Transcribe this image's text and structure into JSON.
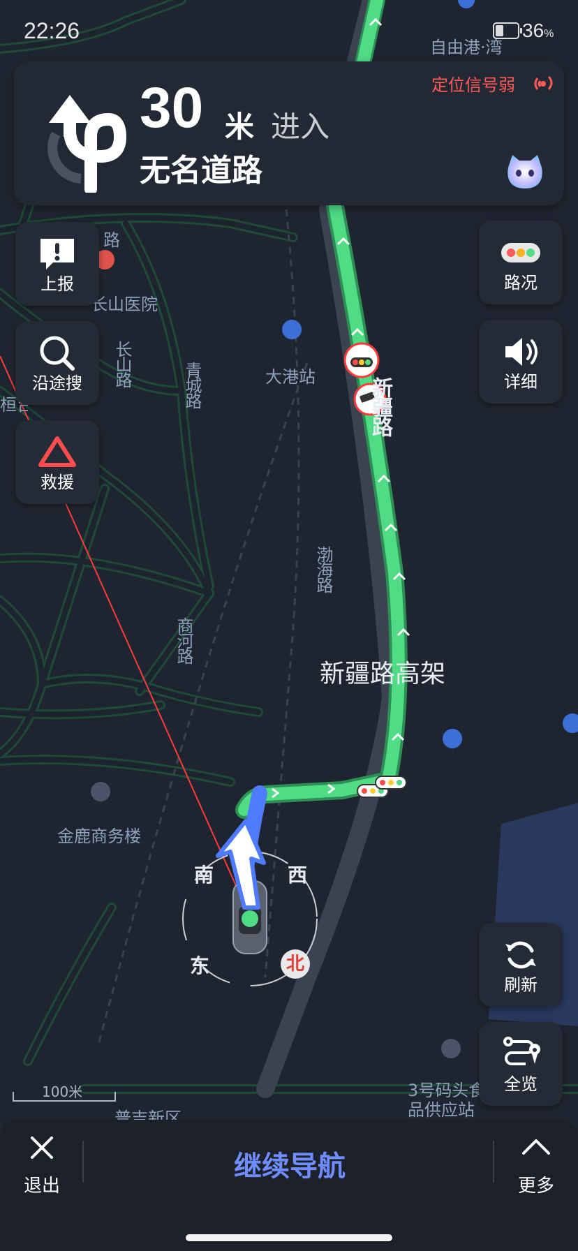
{
  "status": {
    "time": "22:26",
    "battery_pct": "36",
    "battery_unit": "%",
    "battery_level": 0.36
  },
  "nav": {
    "distance": "30",
    "unit": "米",
    "action": "进入",
    "road": "无名道路",
    "signal_warning": "定位信号弱",
    "turn_icon": "u-turn-icon"
  },
  "left_buttons": [
    {
      "label": "上报",
      "icon": "report-icon"
    },
    {
      "label": "沿途搜",
      "icon": "search-icon"
    },
    {
      "label": "救援",
      "icon": "rescue-triangle-icon"
    }
  ],
  "right_buttons": [
    {
      "label": "路况",
      "icon": "traffic-icon"
    },
    {
      "label": "详细",
      "icon": "speaker-icon"
    },
    {
      "label": "刷新",
      "icon": "refresh-icon"
    },
    {
      "label": "全览",
      "icon": "route-overview-icon"
    }
  ],
  "map": {
    "labels": {
      "ziyougang": "自由港·湾",
      "yiyuan": "长山医院",
      "dagang": "大港站",
      "changshan": "长山路",
      "qingcheng": "青城路",
      "xinjiang": "新疆路",
      "bohai": "渤海路",
      "xinjiang_elevated": "新疆路高架",
      "shanghe": "商河路",
      "jinlu": "金鹿商务楼",
      "dock": "3号码头食品供应站",
      "newarea": "普吉新区",
      "road_partial": "路",
      "road_partial2": "桓台路"
    },
    "compass": {
      "south": "南",
      "west": "西",
      "east": "东",
      "north": "北"
    },
    "scale": "100米",
    "route_color": "#4fdc85",
    "turn_arrow_color": "#4e7bff",
    "alert_color": "#ff3b3b"
  },
  "bottom": {
    "exit": "退出",
    "continue": "继续导航",
    "more": "更多"
  }
}
